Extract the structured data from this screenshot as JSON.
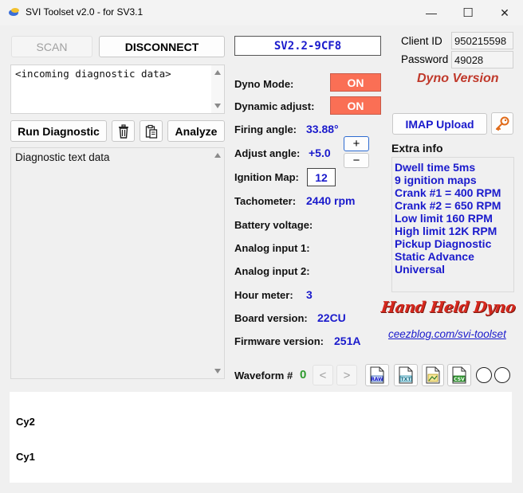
{
  "window": {
    "title": "SVI Toolset v2.0 - for SV3.1",
    "minimize": "—",
    "maximize": "☐",
    "close": "✕"
  },
  "left": {
    "scan_label": "SCAN",
    "disconnect_label": "DISCONNECT",
    "incoming_text": "<incoming diagnostic data>",
    "run_diagnostic_label": "Run Diagnostic",
    "analyze_label": "Analyze",
    "diag_text": "Diagnostic text data"
  },
  "device": {
    "id": "SV2.2-9CF8"
  },
  "readings": {
    "dyno_mode_label": "Dyno Mode:",
    "dyno_mode_value": "ON",
    "dynamic_adjust_label": "Dynamic adjust:",
    "dynamic_adjust_value": "ON",
    "firing_angle_label": "Firing angle:",
    "firing_angle_value": "33.88°",
    "adjust_angle_label": "Adjust angle:",
    "adjust_angle_value": "+5.0",
    "plus_label": "+",
    "minus_label": "−",
    "ignition_map_label": "Ignition Map:",
    "ignition_map_value": "12",
    "tachometer_label": "Tachometer:",
    "tachometer_value": "2440 rpm",
    "battery_label": "Battery voltage:",
    "analog1_label": "Analog input 1:",
    "analog2_label": "Analog input 2:",
    "hour_meter_label": "Hour meter:",
    "hour_meter_value": "3",
    "board_version_label": "Board version:",
    "board_version_value": "22CU",
    "firmware_version_label": "Firmware version:",
    "firmware_version_value": "251A"
  },
  "auth": {
    "client_id_label": "Client ID",
    "client_id_value": "950215598",
    "password_label": "Password",
    "password_value": "49028",
    "version_text": "Dyno Version"
  },
  "right": {
    "imap_upload_label": "IMAP Upload",
    "extra_info_title": "Extra info",
    "extra_info_lines": [
      "Dwell time 5ms",
      "9 ignition maps",
      "Crank #1 = 400 RPM",
      "Crank #2 = 650 RPM",
      "Low limit 160 RPM",
      "High limit 12K RPM",
      "Pickup Diagnostic",
      "Static Advance",
      "Universal"
    ],
    "logo_text": "Hand Held Dyno",
    "link_text": "ceezblog.com/svi-toolset"
  },
  "waveform": {
    "label": "Waveform #",
    "number": "0",
    "prev": "<",
    "next": ">",
    "raw_label": "RAW",
    "txt_label": "TXT",
    "csv_label": "CSV",
    "cy2_label": "Cy2",
    "cy1_label": "Cy1"
  },
  "colors": {
    "on_button": "#fa6f55",
    "value_blue": "#1a1acc",
    "version_red": "#c0392b",
    "number_green": "#2e9a2e"
  }
}
